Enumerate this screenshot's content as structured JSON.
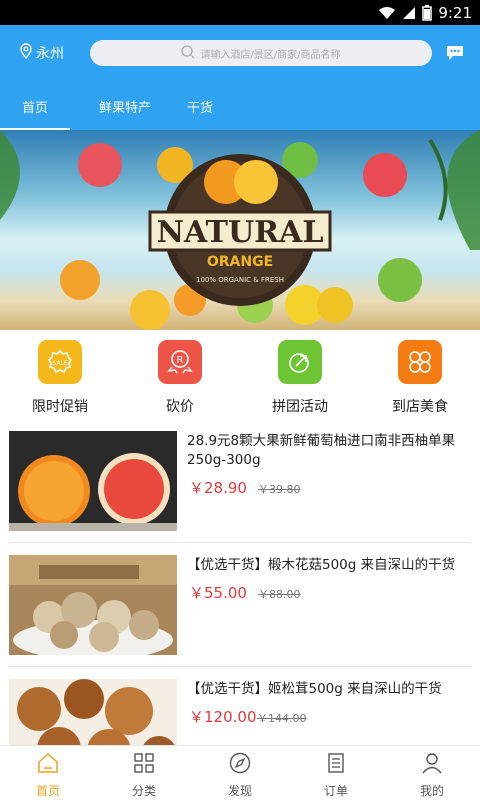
{
  "status_bar": {
    "time": "9:21"
  },
  "header": {
    "location": "永州",
    "search_placeholder": "请输入酒店/景区/商家/商品名称",
    "tabs": [
      "首页",
      "鲜果特产",
      "干货"
    ]
  },
  "banner": {
    "logo_main": "NATURAL",
    "logo_sub": "ORANGE",
    "logo_ribbon": "100% ORGANIC & FRESH"
  },
  "categories": [
    {
      "label": "限时促销",
      "color": "#f5b81b",
      "icon": "sale-badge-icon"
    },
    {
      "label": "砍价",
      "color": "#ee5547",
      "icon": "bargain-ribbon-icon"
    },
    {
      "label": "拼团活动",
      "color": "#6ec534",
      "icon": "group-buy-arrow-icon"
    },
    {
      "label": "到店美食",
      "color": "#f57c12",
      "icon": "grid-food-icon"
    }
  ],
  "products": [
    {
      "title": "28.9元8颗大果新鲜葡萄柚进口南非西柚单果250g-300g",
      "price": "￥28.90",
      "old_price": "￥39.80"
    },
    {
      "title": "【优选干货】椴木花菇500g 来自深山的干货",
      "price": "￥55.00",
      "old_price": "￥88.00"
    },
    {
      "title": "【优选干货】姬松茸500g 来自深山的干货",
      "price": "￥120.00",
      "old_price": "￥144.00"
    }
  ],
  "tabbar": [
    {
      "label": "首页",
      "active": true
    },
    {
      "label": "分类",
      "active": false
    },
    {
      "label": "发现",
      "active": false
    },
    {
      "label": "订单",
      "active": false
    },
    {
      "label": "我的",
      "active": false
    }
  ],
  "colors": {
    "header": "#2fa2f2",
    "price": "#e23a3a",
    "active_tab": "#f0a020"
  }
}
